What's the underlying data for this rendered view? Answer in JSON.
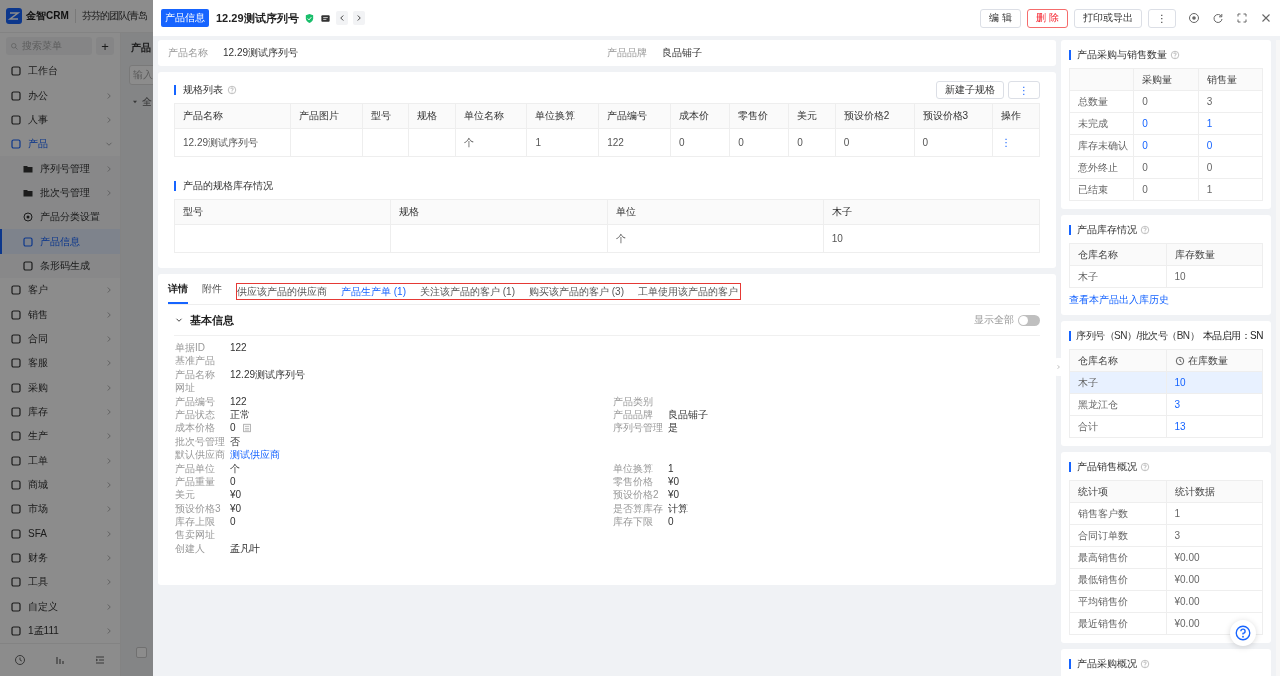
{
  "app": {
    "logo": "金智CRM",
    "team": "芬芬的团队(青岛",
    "search_placeholder": "搜索菜单",
    "add_label": "+"
  },
  "sidebar": {
    "items": [
      {
        "label": "工作台"
      },
      {
        "label": "办公",
        "expanded": false
      },
      {
        "label": "人事",
        "expanded": false
      },
      {
        "label": "产品",
        "expanded": true,
        "children": [
          {
            "label": "序列号管理",
            "selected": false,
            "kind": "folder"
          },
          {
            "label": "批次号管理",
            "selected": false,
            "kind": "folder"
          },
          {
            "label": "产品分类设置",
            "selected": false,
            "kind": "setting"
          },
          {
            "label": "产品信息",
            "selected": true,
            "kind": "page"
          },
          {
            "label": "条形码生成",
            "selected": false,
            "kind": "page"
          }
        ]
      },
      {
        "label": "客户",
        "expanded": false
      },
      {
        "label": "销售",
        "expanded": false
      },
      {
        "label": "合同",
        "expanded": false
      },
      {
        "label": "客服",
        "expanded": false
      },
      {
        "label": "采购",
        "expanded": false
      },
      {
        "label": "库存",
        "expanded": false
      },
      {
        "label": "生产",
        "expanded": false
      },
      {
        "label": "工单",
        "expanded": false
      },
      {
        "label": "商城",
        "expanded": false
      },
      {
        "label": "市场",
        "expanded": false
      },
      {
        "label": "SFA",
        "expanded": false
      },
      {
        "label": "财务",
        "expanded": false
      },
      {
        "label": "工具",
        "expanded": false
      },
      {
        "label": "自定义",
        "expanded": false
      },
      {
        "label": "1孟111",
        "expanded": false
      }
    ]
  },
  "background_page": {
    "title": "产品",
    "search_placeholder": "输入",
    "tree_root": "全",
    "checkbox": {
      "checked": false
    }
  },
  "drawer": {
    "tag": "产品信息",
    "title": "12.29测试序列号",
    "buttons": [
      {
        "label": "编 辑",
        "kind": "default"
      },
      {
        "label": "删 除",
        "kind": "danger"
      },
      {
        "label": "打印或导出",
        "kind": "default"
      },
      {
        "label": "⋮",
        "kind": "more"
      }
    ]
  },
  "summary": {
    "fields": [
      {
        "label": "产品名称",
        "value": "12.29测试序列号"
      },
      {
        "label": "产品品牌",
        "value": "良品铺子"
      }
    ]
  },
  "spec_list": {
    "title": "规格列表",
    "buttons": [
      "新建子规格",
      "⋮"
    ],
    "columns": [
      "产品名称",
      "产品图片",
      "型号",
      "规格",
      "单位名称",
      "单位换算",
      "产品编号",
      "成本价",
      "零售价",
      "美元",
      "预设价格2",
      "预设价格3",
      "操作"
    ],
    "rows": [
      {
        "cells": [
          "12.29测试序列号",
          null,
          null,
          null,
          "个",
          "1",
          "122",
          "0",
          "0",
          "0",
          "0",
          "0"
        ],
        "action": "⋮"
      }
    ]
  },
  "stock_by_spec": {
    "title": "产品的规格库存情况",
    "columns": [
      "型号",
      "规格",
      "单位",
      "木子"
    ],
    "rows": [
      [
        null,
        null,
        "个",
        "10"
      ]
    ]
  },
  "detail": {
    "tabs": [
      {
        "label": "详情",
        "selected": true,
        "annotated": false,
        "highlighted": false
      },
      {
        "label": "附件",
        "selected": false,
        "annotated": false,
        "highlighted": false
      },
      {
        "label": "供应该产品的供应商",
        "selected": false,
        "annotated": true,
        "highlighted": false
      },
      {
        "label": "产品生产单 (1)",
        "selected": false,
        "annotated": true,
        "highlighted": true
      },
      {
        "label": "关注该产品的客户 (1)",
        "selected": false,
        "annotated": true,
        "highlighted": false
      },
      {
        "label": "购买该产品的客户 (3)",
        "selected": false,
        "annotated": true,
        "highlighted": false
      },
      {
        "label": "工单使用该产品的客户",
        "selected": false,
        "annotated": true,
        "highlighted": false
      }
    ],
    "section": {
      "title": "基本信息",
      "expanded": true
    },
    "toggle": {
      "label": "显示全部",
      "on": false
    },
    "rows": [
      {
        "left": {
          "label": "单据ID",
          "value": "122"
        }
      },
      {
        "left": {
          "label": "基准产品"
        }
      },
      {
        "left": {
          "label": "产品名称",
          "value": "12.29测试序列号"
        }
      },
      {
        "left": {
          "label": "网址"
        }
      },
      {
        "left": {
          "label": "产品编号",
          "value": "122"
        },
        "right": {
          "label": "产品类别"
        }
      },
      {
        "left": {
          "label": "产品状态",
          "value": "正常"
        },
        "right": {
          "label": "产品品牌",
          "value": "良品铺子"
        }
      },
      {
        "left": {
          "label": "成本价格",
          "value": "0",
          "kind": "calculator"
        },
        "right": {
          "label": "序列号管理",
          "value": "是"
        }
      },
      {
        "left": {
          "label": "批次号管理",
          "value": "否"
        }
      },
      {
        "left": {
          "label": "默认供应商",
          "value": "测试供应商",
          "kind": "link"
        }
      },
      {
        "left": {
          "label": "产品单位",
          "value": "个"
        },
        "right": {
          "label": "单位换算",
          "value": "1"
        }
      },
      {
        "left": {
          "label": "产品重量",
          "value": "0"
        },
        "right": {
          "label": "零售价格",
          "value": "¥0"
        }
      },
      {
        "left": {
          "label": "美元",
          "value": "¥0"
        },
        "right": {
          "label": "预设价格2",
          "value": "¥0"
        }
      },
      {
        "left": {
          "label": "预设价格3",
          "value": "¥0"
        },
        "right": {
          "label": "是否算库存",
          "value": "计算"
        }
      },
      {
        "left": {
          "label": "库存上限",
          "value": "0"
        },
        "right": {
          "label": "库存下限",
          "value": "0"
        }
      },
      {
        "left": {
          "label": "售卖网址"
        }
      },
      {
        "left": {
          "label": "创建人",
          "value": "孟凡叶"
        }
      }
    ]
  },
  "purchase_sales": {
    "title": "产品采购与销售数量",
    "columns": [
      "采购量",
      "销售量"
    ],
    "rows": [
      {
        "label": "总数量",
        "values": [
          {
            "text": "0",
            "link": false
          },
          {
            "text": "3",
            "link": false
          }
        ]
      },
      {
        "label": "未完成",
        "values": [
          {
            "text": "0",
            "link": true
          },
          {
            "text": "1",
            "link": true
          }
        ]
      },
      {
        "label": "库存未确认",
        "values": [
          {
            "text": "0",
            "link": true
          },
          {
            "text": "0",
            "link": true
          }
        ]
      },
      {
        "label": "意外终止",
        "values": [
          {
            "text": "0",
            "link": false
          },
          {
            "text": "0",
            "link": false
          }
        ]
      },
      {
        "label": "已结束",
        "values": [
          {
            "text": "0",
            "link": false
          },
          {
            "text": "1",
            "link": false
          }
        ]
      }
    ]
  },
  "inventory": {
    "title": "产品库存情况",
    "columns": [
      "仓库名称",
      "库存数量"
    ],
    "rows": [
      [
        "木子",
        "10"
      ]
    ],
    "link": "查看本产品出入库历史"
  },
  "serial": {
    "title": "序列号（SN）/批次号（BN）",
    "enabled": "本品启用：SN",
    "columns": [
      "仓库名称",
      "在库数量"
    ],
    "rows": [
      {
        "warehouse": "木子",
        "count": "10",
        "selected": true
      },
      {
        "warehouse": "黑龙江仓",
        "count": "3",
        "selected": false
      },
      {
        "warehouse": "合计",
        "count": "13",
        "selected": false
      }
    ]
  },
  "sales_overview": {
    "title": "产品销售概况",
    "columns": [
      "统计项",
      "统计数据"
    ],
    "rows": [
      [
        "销售客户数",
        "1"
      ],
      [
        "合同订单数",
        "3"
      ],
      [
        "最高销售价",
        "¥0.00"
      ],
      [
        "最低销售价",
        "¥0.00"
      ],
      [
        "平均销售价",
        "¥0.00"
      ],
      [
        "最近销售价",
        "¥0.00"
      ]
    ]
  },
  "purchase_overview": {
    "title": "产品采购概况"
  }
}
